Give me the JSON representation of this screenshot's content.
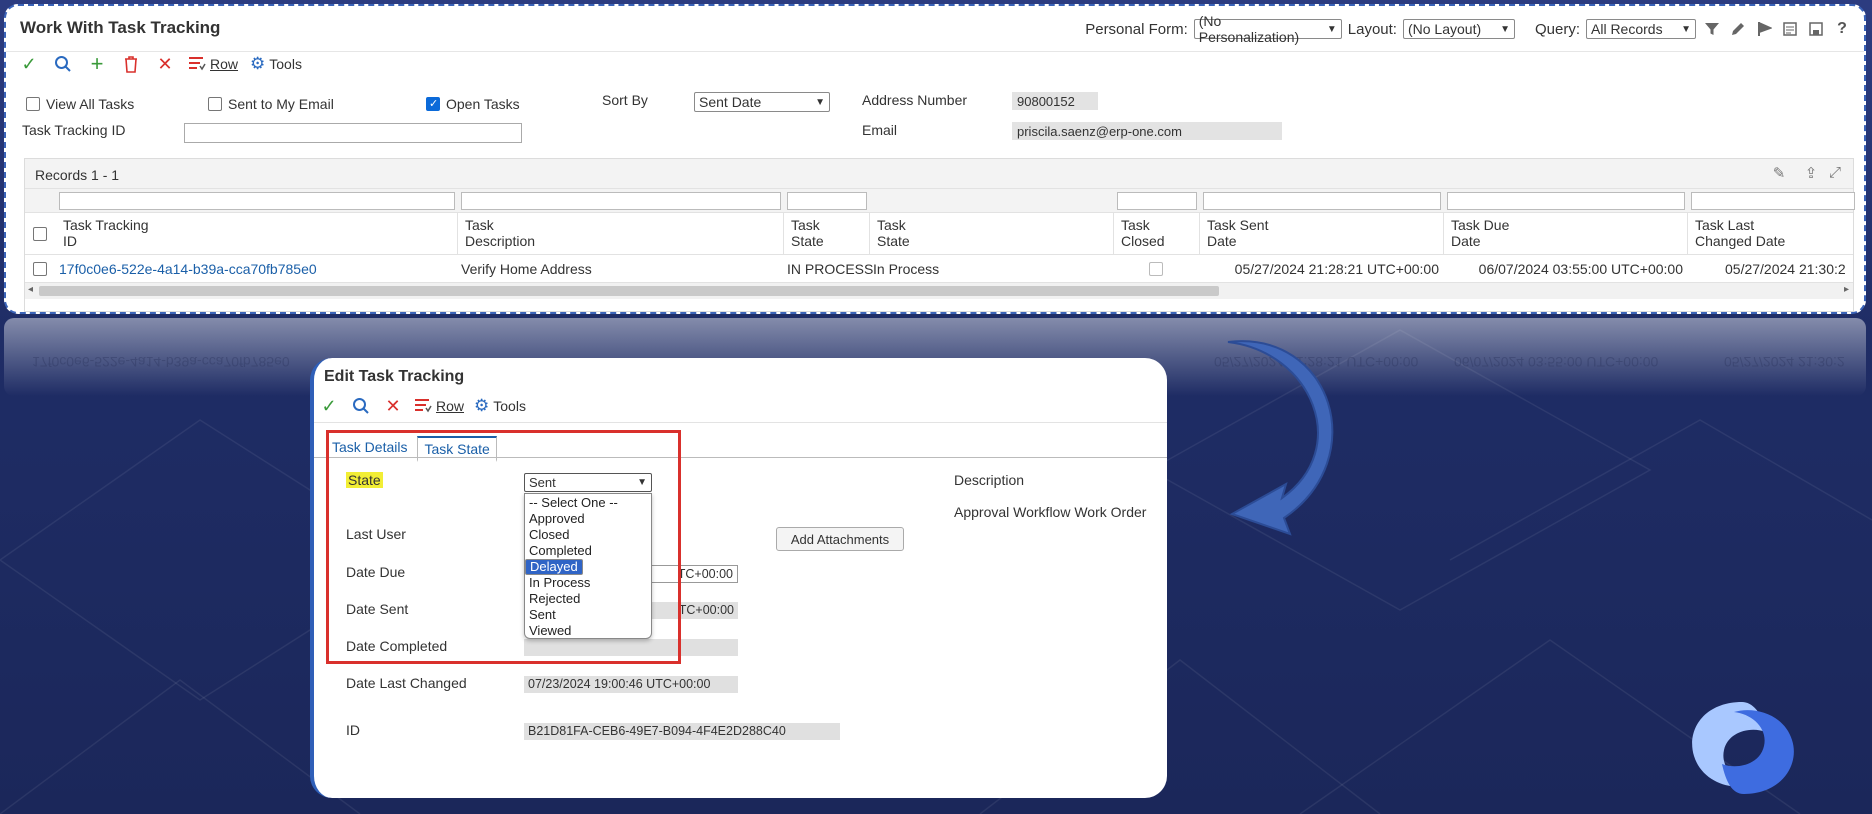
{
  "workwith": {
    "title": "Work With Task Tracking",
    "personal_form_label": "Personal Form:",
    "personal_form_value": "(No Personalization)",
    "layout_label": "Layout:",
    "layout_value": "(No Layout)",
    "query_label": "Query:",
    "query_value": "All Records",
    "toolbar": {
      "row_label": "Row",
      "tools_label": "Tools"
    },
    "filters": {
      "view_all_tasks": "View All Tasks",
      "sent_to_my_email": "Sent to My Email",
      "open_tasks": "Open Tasks",
      "sort_by_label": "Sort By",
      "sort_by_value": "Sent Date",
      "address_number_label": "Address Number",
      "address_number_value": "90800152",
      "task_tracking_id_label": "Task Tracking ID",
      "email_label": "Email",
      "email_value": "priscila.saenz@erp-one.com"
    },
    "grid": {
      "records": "Records 1 - 1",
      "headers": {
        "id_1": "Task Tracking",
        "id_2": "ID",
        "desc_1": "Task",
        "desc_2": "Description",
        "state_code_1": "Task",
        "state_code_2": "State",
        "state_1": "Task",
        "state_2": "State",
        "closed_1": "Task",
        "closed_2": "Closed",
        "sent_1": "Task Sent",
        "sent_2": "Date",
        "due_1": "Task Due",
        "due_2": "Date",
        "changed_1": "Task Last",
        "changed_2": "Changed Date"
      },
      "row": {
        "id": "17f0c0e6-522e-4a14-b39a-cca70fb785e0",
        "description": "Verify Home Address",
        "state_code": "IN PROCESS",
        "state": "In Process",
        "sent_date": "05/27/2024 21:28:21 UTC+00:00",
        "due_date": "06/07/2024 03:55:00 UTC+00:00",
        "changed_date": "05/27/2024 21:30:2"
      }
    }
  },
  "reflection": {
    "id": "17f0c0e6-522e-4a14-b39a-cca70fb785e0",
    "sent": "05/27/2024 21:28:21 UTC+00:00",
    "due": "06/07/2024 03:55:00 UTC+00:00",
    "changed": "05/27/2024 21:30:2"
  },
  "edit": {
    "title": "Edit Task Tracking",
    "toolbar": {
      "row_label": "Row",
      "tools_label": "Tools"
    },
    "tabs": [
      "Task Details",
      "Task State"
    ],
    "state_label": "State",
    "state_value": "Sent",
    "state_options": [
      "-- Select One --",
      "Approved",
      "Closed",
      "Completed",
      "Delayed",
      "In Process",
      "Rejected",
      "Sent",
      "Viewed"
    ],
    "state_highlighted": "Delayed",
    "last_user_label": "Last User",
    "date_due_label": "Date Due",
    "date_due_value": "TC+00:00",
    "date_sent_label": "Date Sent",
    "date_sent_value": "TC+00:00",
    "date_completed_label": "Date Completed",
    "date_last_changed_label": "Date Last Changed",
    "date_last_changed_value": "07/23/2024 19:00:46 UTC+00:00",
    "id_label": "ID",
    "id_value": "B21D81FA-CEB6-49E7-B094-4F4E2D288C40",
    "add_attachments": "Add Attachments",
    "description_label": "Description",
    "description_value": "Approval Workflow Work Order"
  },
  "colors": {
    "accent": "#1a5fa8",
    "highlight": "#f2ee35",
    "annotation": "#d9302c",
    "selected_option": "#2f64c6"
  }
}
